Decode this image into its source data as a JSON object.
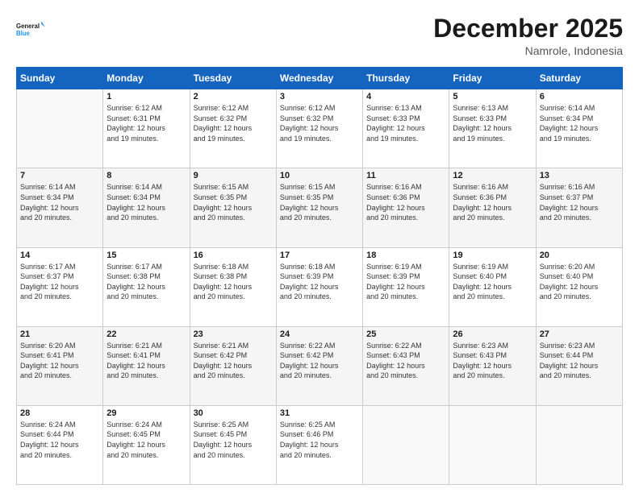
{
  "logo": {
    "line1": "General",
    "line2": "Blue"
  },
  "title": "December 2025",
  "subtitle": "Namrole, Indonesia",
  "days_header": [
    "Sunday",
    "Monday",
    "Tuesday",
    "Wednesday",
    "Thursday",
    "Friday",
    "Saturday"
  ],
  "weeks": [
    [
      {
        "num": "",
        "info": ""
      },
      {
        "num": "1",
        "info": "Sunrise: 6:12 AM\nSunset: 6:31 PM\nDaylight: 12 hours\nand 19 minutes."
      },
      {
        "num": "2",
        "info": "Sunrise: 6:12 AM\nSunset: 6:32 PM\nDaylight: 12 hours\nand 19 minutes."
      },
      {
        "num": "3",
        "info": "Sunrise: 6:12 AM\nSunset: 6:32 PM\nDaylight: 12 hours\nand 19 minutes."
      },
      {
        "num": "4",
        "info": "Sunrise: 6:13 AM\nSunset: 6:33 PM\nDaylight: 12 hours\nand 19 minutes."
      },
      {
        "num": "5",
        "info": "Sunrise: 6:13 AM\nSunset: 6:33 PM\nDaylight: 12 hours\nand 19 minutes."
      },
      {
        "num": "6",
        "info": "Sunrise: 6:14 AM\nSunset: 6:34 PM\nDaylight: 12 hours\nand 19 minutes."
      }
    ],
    [
      {
        "num": "7",
        "info": "Sunrise: 6:14 AM\nSunset: 6:34 PM\nDaylight: 12 hours\nand 20 minutes."
      },
      {
        "num": "8",
        "info": "Sunrise: 6:14 AM\nSunset: 6:34 PM\nDaylight: 12 hours\nand 20 minutes."
      },
      {
        "num": "9",
        "info": "Sunrise: 6:15 AM\nSunset: 6:35 PM\nDaylight: 12 hours\nand 20 minutes."
      },
      {
        "num": "10",
        "info": "Sunrise: 6:15 AM\nSunset: 6:35 PM\nDaylight: 12 hours\nand 20 minutes."
      },
      {
        "num": "11",
        "info": "Sunrise: 6:16 AM\nSunset: 6:36 PM\nDaylight: 12 hours\nand 20 minutes."
      },
      {
        "num": "12",
        "info": "Sunrise: 6:16 AM\nSunset: 6:36 PM\nDaylight: 12 hours\nand 20 minutes."
      },
      {
        "num": "13",
        "info": "Sunrise: 6:16 AM\nSunset: 6:37 PM\nDaylight: 12 hours\nand 20 minutes."
      }
    ],
    [
      {
        "num": "14",
        "info": "Sunrise: 6:17 AM\nSunset: 6:37 PM\nDaylight: 12 hours\nand 20 minutes."
      },
      {
        "num": "15",
        "info": "Sunrise: 6:17 AM\nSunset: 6:38 PM\nDaylight: 12 hours\nand 20 minutes."
      },
      {
        "num": "16",
        "info": "Sunrise: 6:18 AM\nSunset: 6:38 PM\nDaylight: 12 hours\nand 20 minutes."
      },
      {
        "num": "17",
        "info": "Sunrise: 6:18 AM\nSunset: 6:39 PM\nDaylight: 12 hours\nand 20 minutes."
      },
      {
        "num": "18",
        "info": "Sunrise: 6:19 AM\nSunset: 6:39 PM\nDaylight: 12 hours\nand 20 minutes."
      },
      {
        "num": "19",
        "info": "Sunrise: 6:19 AM\nSunset: 6:40 PM\nDaylight: 12 hours\nand 20 minutes."
      },
      {
        "num": "20",
        "info": "Sunrise: 6:20 AM\nSunset: 6:40 PM\nDaylight: 12 hours\nand 20 minutes."
      }
    ],
    [
      {
        "num": "21",
        "info": "Sunrise: 6:20 AM\nSunset: 6:41 PM\nDaylight: 12 hours\nand 20 minutes."
      },
      {
        "num": "22",
        "info": "Sunrise: 6:21 AM\nSunset: 6:41 PM\nDaylight: 12 hours\nand 20 minutes."
      },
      {
        "num": "23",
        "info": "Sunrise: 6:21 AM\nSunset: 6:42 PM\nDaylight: 12 hours\nand 20 minutes."
      },
      {
        "num": "24",
        "info": "Sunrise: 6:22 AM\nSunset: 6:42 PM\nDaylight: 12 hours\nand 20 minutes."
      },
      {
        "num": "25",
        "info": "Sunrise: 6:22 AM\nSunset: 6:43 PM\nDaylight: 12 hours\nand 20 minutes."
      },
      {
        "num": "26",
        "info": "Sunrise: 6:23 AM\nSunset: 6:43 PM\nDaylight: 12 hours\nand 20 minutes."
      },
      {
        "num": "27",
        "info": "Sunrise: 6:23 AM\nSunset: 6:44 PM\nDaylight: 12 hours\nand 20 minutes."
      }
    ],
    [
      {
        "num": "28",
        "info": "Sunrise: 6:24 AM\nSunset: 6:44 PM\nDaylight: 12 hours\nand 20 minutes."
      },
      {
        "num": "29",
        "info": "Sunrise: 6:24 AM\nSunset: 6:45 PM\nDaylight: 12 hours\nand 20 minutes."
      },
      {
        "num": "30",
        "info": "Sunrise: 6:25 AM\nSunset: 6:45 PM\nDaylight: 12 hours\nand 20 minutes."
      },
      {
        "num": "31",
        "info": "Sunrise: 6:25 AM\nSunset: 6:46 PM\nDaylight: 12 hours\nand 20 minutes."
      },
      {
        "num": "",
        "info": ""
      },
      {
        "num": "",
        "info": ""
      },
      {
        "num": "",
        "info": ""
      }
    ]
  ]
}
